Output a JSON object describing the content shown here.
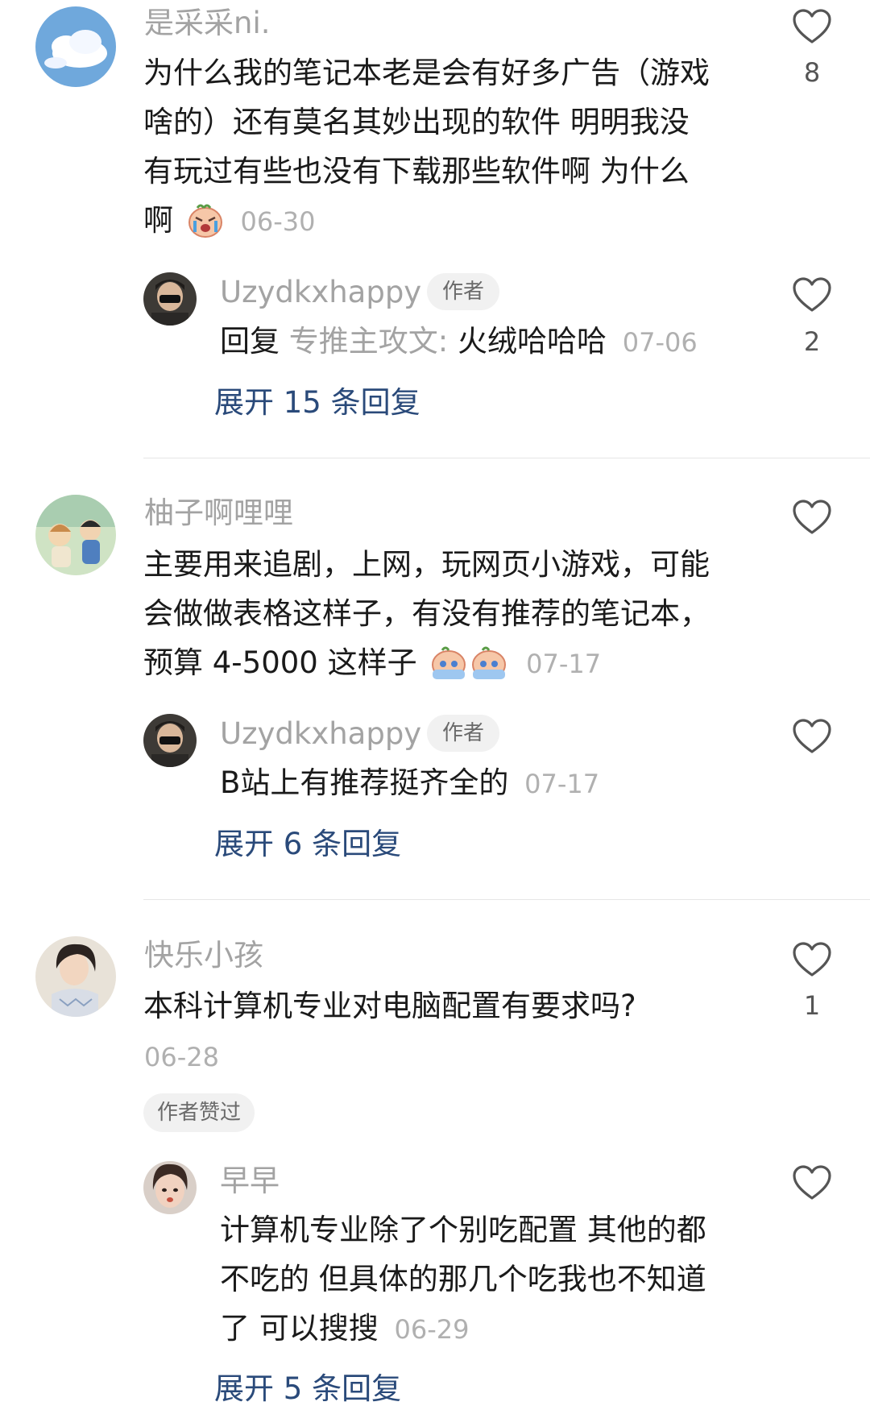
{
  "comments": [
    {
      "username": "是采采ni.",
      "text_lines": [
        "为什么我的笔记本老是会有好多广告（游戏",
        "啥的）还有莫名其妙出现的软件  明明我没",
        "有玩过有些也没有下载那些软件啊 为什么",
        "啊"
      ],
      "emoji": "crying-face-emoji",
      "date": "06-30",
      "likes": "8",
      "reply": {
        "username": "Uzydkxhappy",
        "badge": "作者",
        "prefix": "回复",
        "quoted_user": "专推主攻文:",
        "text": "火绒哈哈哈",
        "date": "07-06",
        "likes": "2"
      },
      "expand": "展开 15 条回复"
    },
    {
      "username": "柚子啊哩哩",
      "text_lines": [
        "主要用来追剧，上网，玩网页小游戏，可能",
        "会做做表格这样子，有没有推荐的笔记本，",
        "预算 4-5000 这样子"
      ],
      "emoji": "pleading-face-emoji",
      "date": "07-17",
      "reply": {
        "username": "Uzydkxhappy",
        "badge": "作者",
        "text": "B站上有推荐挺齐全的",
        "date": "07-17"
      },
      "expand": "展开 6 条回复"
    },
    {
      "username": "快乐小孩",
      "text_lines": [
        "本科计算机专业对电脑配置有要求吗?"
      ],
      "date": "06-28",
      "likes": "1",
      "liked_badge": "作者赞过",
      "reply": {
        "username": "早早",
        "text_lines": [
          "计算机专业除了个别吃配置 其他的都",
          "不吃的 但具体的那几个吃我也不知道",
          "了 可以搜搜"
        ],
        "date": "06-29"
      },
      "expand": "展开 5 条回复"
    }
  ],
  "colors": {
    "link": "#2a4a7a",
    "username": "#a3a3a3",
    "badge_bg": "#f1f1f1"
  }
}
